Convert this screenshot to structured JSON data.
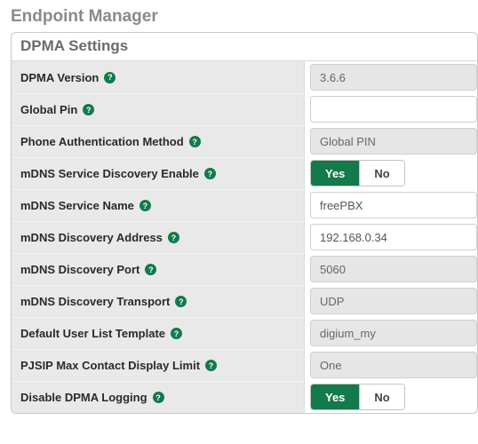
{
  "page_title": "Endpoint Manager",
  "panel_title": "DPMA Settings",
  "help_icon_char": "?",
  "toggle_labels": {
    "yes": "Yes",
    "no": "No"
  },
  "rows": [
    {
      "label": "DPMA Version",
      "type": "select_disabled",
      "value": "3.6.6",
      "name": "dpma-version"
    },
    {
      "label": "Global Pin",
      "type": "text",
      "value": "",
      "name": "global-pin"
    },
    {
      "label": "Phone Authentication Method",
      "type": "select_disabled",
      "value": "Global PIN",
      "name": "phone-auth-method"
    },
    {
      "label": "mDNS Service Discovery Enable",
      "type": "toggle",
      "value": "yes",
      "name": "mdns-enable"
    },
    {
      "label": "mDNS Service Name",
      "type": "text",
      "value": "freePBX",
      "name": "mdns-service-name"
    },
    {
      "label": "mDNS Discovery Address",
      "type": "text",
      "value": "192.168.0.34",
      "name": "mdns-address"
    },
    {
      "label": "mDNS Discovery Port",
      "type": "select_disabled",
      "value": "5060",
      "name": "mdns-port"
    },
    {
      "label": "mDNS Discovery Transport",
      "type": "select_disabled",
      "value": "UDP",
      "name": "mdns-transport"
    },
    {
      "label": "Default User List Template",
      "type": "select_disabled",
      "value": "digium_my",
      "name": "default-template"
    },
    {
      "label": "PJSIP Max Contact Display Limit",
      "type": "select_disabled",
      "value": "One",
      "name": "pjsip-max-contact"
    },
    {
      "label": "Disable DPMA Logging",
      "type": "toggle",
      "value": "yes",
      "name": "disable-logging"
    }
  ]
}
